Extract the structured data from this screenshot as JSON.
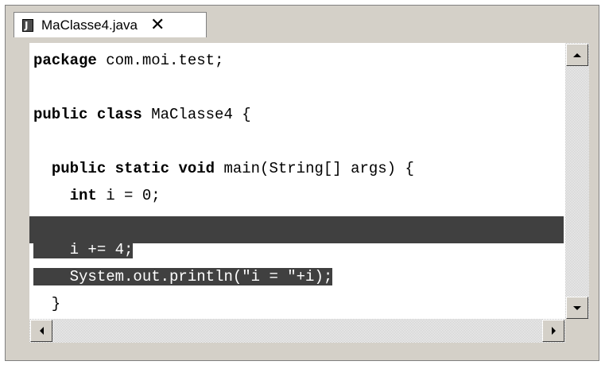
{
  "tab": {
    "title": "MaClasse4.java",
    "icon": "java-file-icon",
    "icon_glyph": "J",
    "close_glyph": "✕"
  },
  "code_lines": [
    {
      "kw": "package",
      "rest": " com.moi.test;"
    },
    {
      "kw": "",
      "rest": ""
    },
    {
      "kw": "public class",
      "rest": " MaClasse4 {"
    },
    {
      "kw": "",
      "rest": ""
    },
    {
      "indent": "  ",
      "kw": "public static void",
      "rest": " main(String[] args) {"
    },
    {
      "indent": "    ",
      "kw": "int",
      "rest": " i = 0;"
    },
    {
      "kw": "",
      "rest": ""
    },
    {
      "text": "    i += 4;"
    },
    {
      "text": "    System.out.println(\"i = \"+i);"
    },
    {
      "text": "  }"
    },
    {
      "text": "}"
    }
  ],
  "selection": {
    "lines": [
      "    i += 4;",
      "    System.out.println(\"i = \"+i);"
    ],
    "color": "#404040"
  },
  "colors": {
    "chrome": "#d4d0c8",
    "editor_bg": "#ffffff"
  }
}
